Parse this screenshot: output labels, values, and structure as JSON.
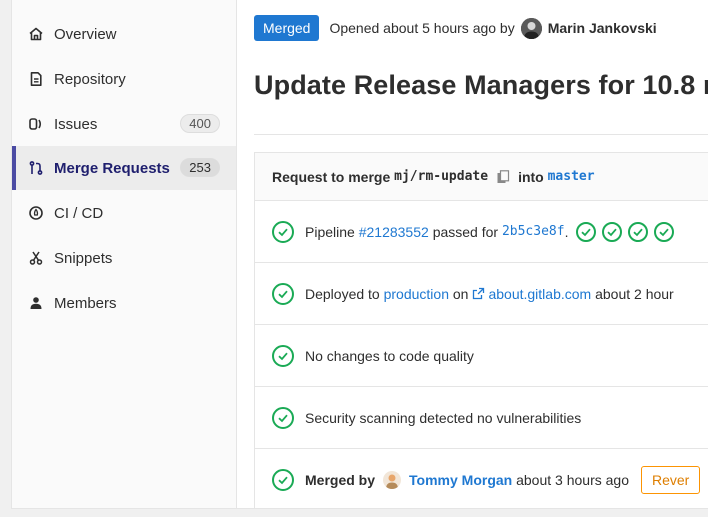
{
  "sidebar": {
    "items": [
      {
        "label": "Overview",
        "icon": "home-icon"
      },
      {
        "label": "Repository",
        "icon": "document-icon"
      },
      {
        "label": "Issues",
        "icon": "issues-icon",
        "count": "400"
      },
      {
        "label": "Merge Requests",
        "icon": "merge-request-icon",
        "count": "253",
        "active": true
      },
      {
        "label": "CI / CD",
        "icon": "rocket-icon"
      },
      {
        "label": "Snippets",
        "icon": "scissors-icon"
      },
      {
        "label": "Members",
        "icon": "user-icon"
      }
    ]
  },
  "header": {
    "status_badge": "Merged",
    "opened_text": "Opened about 5 hours ago by",
    "author": "Marin Jankovski",
    "title": "Update Release Managers for 10.8 r"
  },
  "widget": {
    "request_prefix": "Request to merge",
    "source_branch": "mj/rm-update",
    "into_text": "into",
    "target_branch": "master",
    "pipeline": {
      "prefix": "Pipeline",
      "id": "#21283552",
      "middle": "passed for",
      "commit": "2b5c3e8f",
      "suffix": "."
    },
    "deployment": {
      "prefix": "Deployed to",
      "env": "production",
      "on": "on",
      "host": "about.gitlab.com",
      "time": "about 2 hour"
    },
    "code_quality": "No changes to code quality",
    "security": "Security scanning detected no vulnerabilities",
    "merged": {
      "prefix": "Merged by",
      "user": "Tommy Morgan",
      "time": "about 3 hours ago",
      "revert_label": "Rever"
    }
  },
  "colors": {
    "accent": "#1f78d1",
    "success": "#1aaa55",
    "active_nav": "#4b4ba3",
    "revert": "#fc9403"
  }
}
